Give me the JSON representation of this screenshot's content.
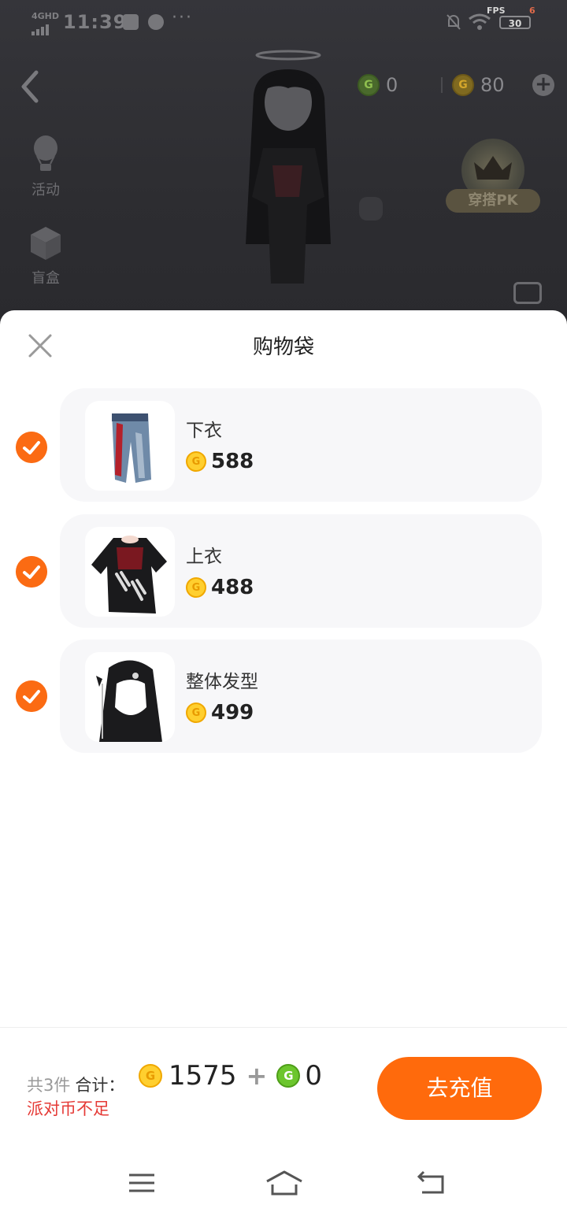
{
  "status_bar": {
    "network": "4GHD",
    "time": "11:39",
    "more": "···",
    "fps_label": "FPS",
    "fps_value": "6",
    "battery": "30"
  },
  "scene": {
    "currency_green": "0",
    "currency_gold": "80",
    "side_items": [
      {
        "label": "活动",
        "icon": "hot-air-balloon-icon"
      },
      {
        "label": "盲盒",
        "icon": "mystery-box-icon"
      }
    ],
    "pk_label": "穿搭PK"
  },
  "sheet": {
    "title": "购物袋",
    "items": [
      {
        "name": "下衣",
        "price": "588",
        "checked": true,
        "icon": "jeans-thumbnail"
      },
      {
        "name": "上衣",
        "price": "488",
        "checked": true,
        "icon": "tshirt-thumbnail"
      },
      {
        "name": "整体发型",
        "price": "499",
        "checked": true,
        "icon": "hairstyle-thumbnail"
      }
    ]
  },
  "footer": {
    "count_text": "共3件",
    "sum_label": "合计：",
    "gold_total": "1575",
    "plus": "+",
    "green_total": "0",
    "warning": "派对币不足",
    "button_label": "去充值"
  },
  "colors": {
    "accent": "#ff6a0c",
    "check": "#fb6b13",
    "warning": "#e53935",
    "gold_coin": "#ffcf2f",
    "green_coin": "#6cc62d"
  }
}
